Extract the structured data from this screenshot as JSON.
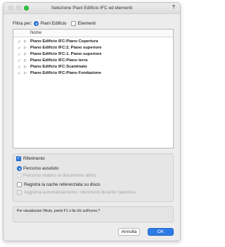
{
  "window": {
    "title": "Selezione Piani Edificio IFC ed elementi",
    "help_glyph": "?"
  },
  "filter": {
    "label": "Filtra per:",
    "options": [
      {
        "label": "Piani Edificio",
        "selected": true
      },
      {
        "label": "Elementi",
        "selected": false
      }
    ]
  },
  "list": {
    "column_name": "Nome",
    "rows": [
      {
        "name": "Piano Edificio IFC:Piano Copertura",
        "checked": true,
        "check_glyph": "✓",
        "expander_glyph": "▷"
      },
      {
        "name": "Piano Edificio IFC:2. Piano superiore",
        "checked": true,
        "check_glyph": "✓",
        "expander_glyph": "▷"
      },
      {
        "name": "Piano Edificio IFC:1. Piano superiore",
        "checked": true,
        "check_glyph": "✓",
        "expander_glyph": "▷"
      },
      {
        "name": "Piano Edificio IFC:Piano terra",
        "checked": true,
        "check_glyph": "✓",
        "expander_glyph": "▷"
      },
      {
        "name": "Piano Edificio IFC:Scantinato",
        "checked": true,
        "check_glyph": "✓",
        "expander_glyph": "▷"
      },
      {
        "name": "Piano Edificio IFC:Piano Fondazione",
        "checked": true,
        "check_glyph": "✓",
        "expander_glyph": "▷"
      }
    ]
  },
  "reference": {
    "title": "Riferimento",
    "checked": true,
    "absolute_path_label": "Percorso assoluto",
    "relative_path_label": "Percorso relativo al documento attivo",
    "cache_label": "Registra la cache referenziata su disco",
    "auto_update_label": "Aggiorna automaticamente i riferimenti durante l'apertura"
  },
  "help": {
    "text": "Per visualizzare l'Aiuto, premi F1 o fai clic sull'icona ?"
  },
  "buttons": {
    "cancel": "Annulla",
    "ok": "OK"
  },
  "colors": {
    "accent": "#2d7be5",
    "traffic_green": "#2ec840"
  }
}
